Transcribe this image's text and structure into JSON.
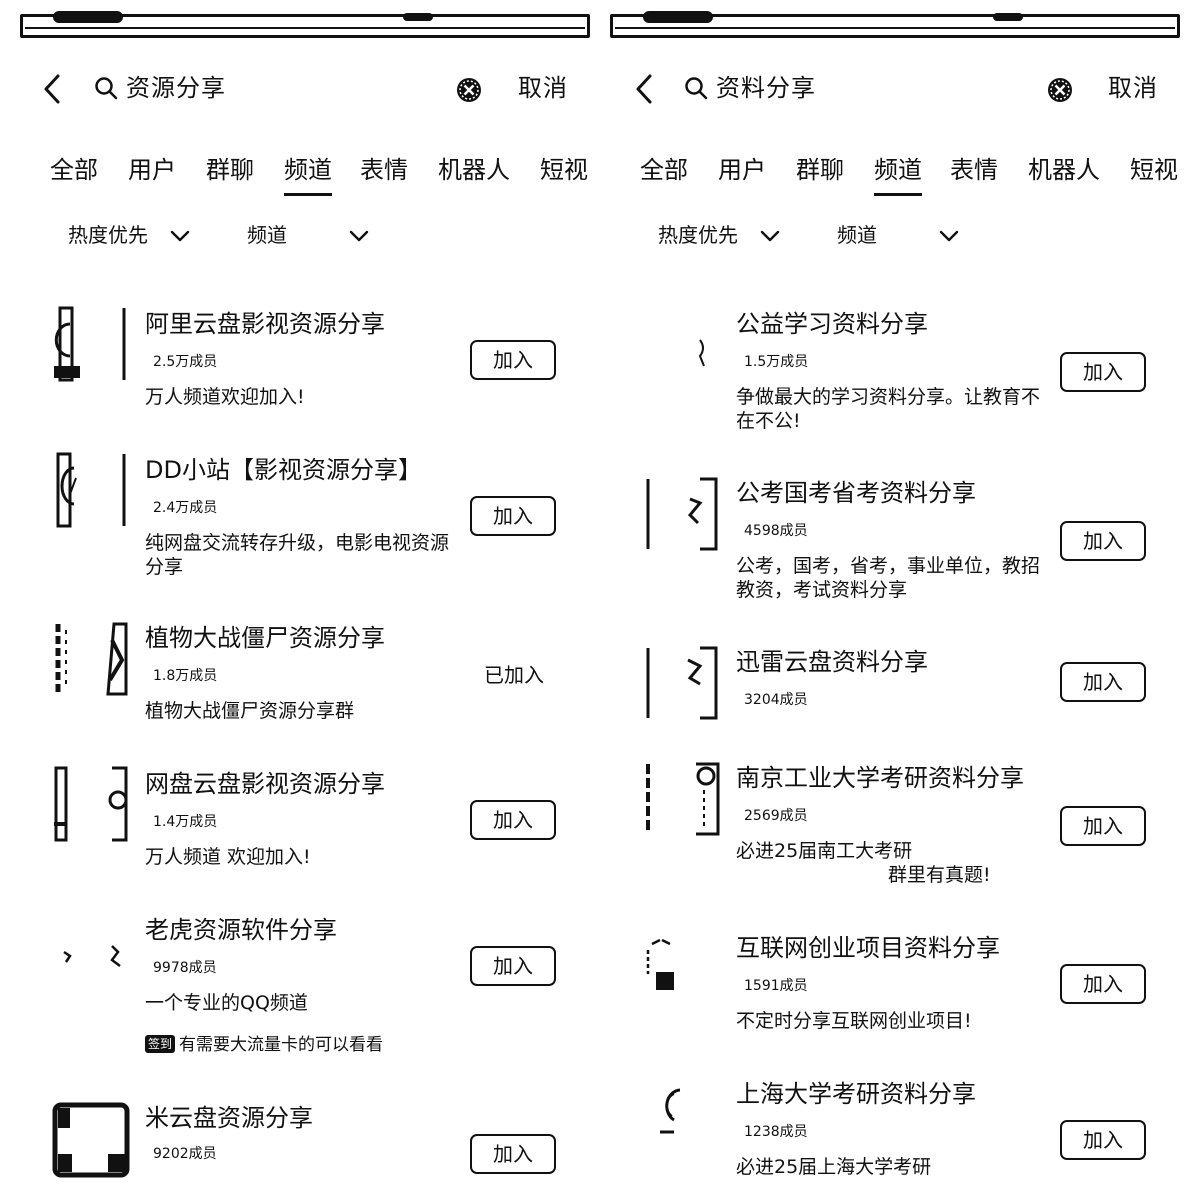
{
  "left": {
    "query": "资源分享",
    "cancel_label": "取消",
    "tabs": [
      {
        "label": "全部"
      },
      {
        "label": "用户"
      },
      {
        "label": "群聊"
      },
      {
        "label": "频道",
        "active": true
      },
      {
        "label": "表情"
      },
      {
        "label": "机器人"
      },
      {
        "label": "短视"
      }
    ],
    "filters": [
      "热度优先",
      "频道"
    ],
    "results": [
      {
        "title": "阿里云盘影视资源分享",
        "members": "2.5万成员",
        "desc": "万人频道欢迎加入!",
        "action": "加入"
      },
      {
        "title": "DD小站【影视资源分享】",
        "members": "2.4万成员",
        "desc": "纯网盘交流转存升级，电影电视资源分享",
        "action": "加入"
      },
      {
        "title": "植物大战僵尸资源分享",
        "members": "1.8万成员",
        "desc": "植物大战僵尸资源分享群",
        "action": "已加入"
      },
      {
        "title": "网盘云盘影视资源分享",
        "members": "1.4万成员",
        "desc": "万人频道 欢迎加入!",
        "action": "加入"
      },
      {
        "title": "老虎资源软件分享",
        "members": "9978成员",
        "desc": "一个专业的QQ频道",
        "tag": "有需要大流量卡的可以看看",
        "action": "加入"
      },
      {
        "title": "米云盘资源分享",
        "members": "9202成员",
        "desc": "",
        "action": "加入"
      }
    ]
  },
  "right": {
    "query": "资料分享",
    "cancel_label": "取消",
    "tabs": [
      {
        "label": "全部"
      },
      {
        "label": "用户"
      },
      {
        "label": "群聊"
      },
      {
        "label": "频道",
        "active": true
      },
      {
        "label": "表情"
      },
      {
        "label": "机器人"
      },
      {
        "label": "短视"
      }
    ],
    "filters": [
      "热度优先",
      "频道"
    ],
    "results": [
      {
        "title": "公益学习资料分享",
        "members": "1.5万成员",
        "desc": "争做最大的学习资料分享。让教育不在不公!",
        "action": "加入"
      },
      {
        "title": "公考国考省考资料分享",
        "members": "4598成员",
        "desc": "公考，国考，省考，事业单位，教招教资，考试资料分享",
        "action": "加入"
      },
      {
        "title": "迅雷云盘资料分享",
        "members": "3204成员",
        "desc": "",
        "action": "加入"
      },
      {
        "title": "南京工业大学考研资料分享",
        "members": "2569成员",
        "desc": "必进25届南工大考研",
        "desc2": "群里有真题!",
        "action": "加入"
      },
      {
        "title": "互联网创业项目资料分享",
        "members": "1591成员",
        "desc": "不定时分享互联网创业项目!",
        "action": "加入"
      },
      {
        "title": "上海大学考研资料分享",
        "members": "1238成员",
        "desc": "必进25届上海大学考研",
        "action": "加入"
      }
    ]
  },
  "tag_badge": "签到",
  "icons": [
    "back-arrow-icon",
    "search-icon",
    "clear-icon",
    "chevron-down-icon",
    "channel-avatar"
  ]
}
